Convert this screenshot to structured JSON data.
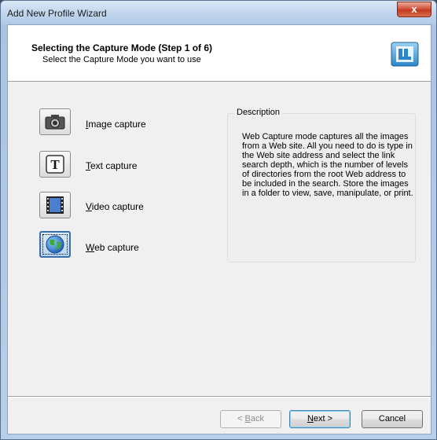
{
  "window": {
    "title": "Add New Profile Wizard",
    "close_symbol": "x"
  },
  "header": {
    "title": "Selecting the Capture Mode (Step 1 of 6)",
    "subtitle": "Select the Capture Mode you want to use",
    "logo_icon": "wizard-logo-icon"
  },
  "modes": [
    {
      "label_accel": "I",
      "label_rest": "mage capture",
      "icon": "camera-icon",
      "selected": false
    },
    {
      "label_accel": "T",
      "label_rest": "ext capture",
      "icon": "text-t-icon",
      "selected": false
    },
    {
      "label_accel": "V",
      "label_rest": "ideo capture",
      "icon": "film-icon",
      "selected": false
    },
    {
      "label_accel": "W",
      "label_rest": "eb capture",
      "icon": "globe-icon",
      "selected": true
    }
  ],
  "description": {
    "legend": "Description",
    "text": "Web Capture mode captures all the images from a Web site. All you need to do is type in the Web site address and select the link search depth, which is the number of levels of directories from the root Web address to be included in the search. Store the images in a folder to view, save, manipulate, or print."
  },
  "buttons": {
    "back_prefix": "< ",
    "back_accel": "B",
    "back_rest": "ack",
    "next_accel": "N",
    "next_rest": "ext >",
    "cancel": "Cancel"
  },
  "colors": {
    "selection_border": "#3c6fa8",
    "close_red": "#c23a1f"
  }
}
